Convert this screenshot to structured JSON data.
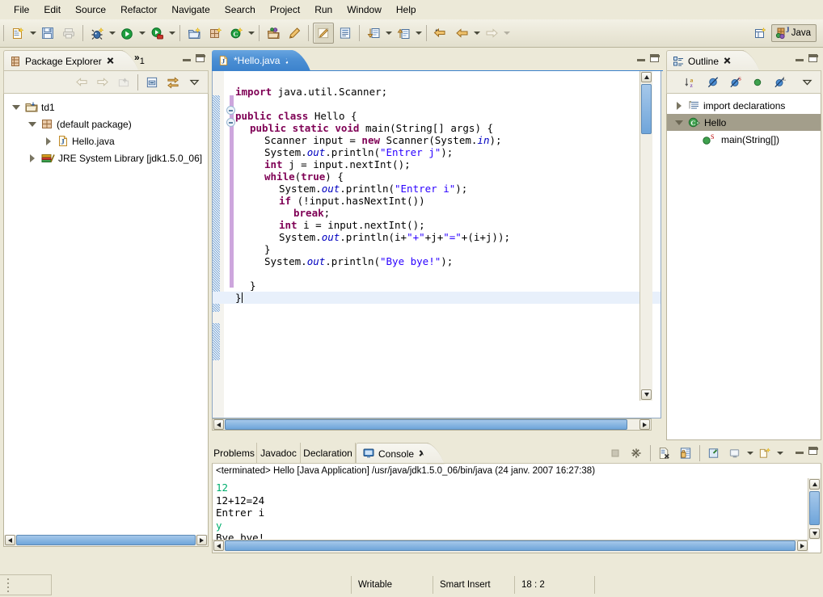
{
  "window": {
    "perspective": "Java"
  },
  "menu": {
    "items": [
      "File",
      "Edit",
      "Source",
      "Refactor",
      "Navigate",
      "Search",
      "Project",
      "Run",
      "Window",
      "Help"
    ]
  },
  "toolbar": {
    "groups": [
      {
        "buttons": [
          {
            "name": "new-wizard",
            "icon": "new-java-file-icon",
            "dropdown": true,
            "pressed": false
          },
          {
            "name": "save",
            "icon": "save-icon",
            "dropdown": false,
            "pressed": false
          },
          {
            "name": "print",
            "icon": "print-icon",
            "dropdown": false,
            "pressed": false
          }
        ]
      },
      {
        "buttons": [
          {
            "name": "debug",
            "icon": "debug-bug-icon",
            "dropdown": true,
            "pressed": false
          },
          {
            "name": "run",
            "icon": "run-play-icon",
            "dropdown": true,
            "pressed": false
          },
          {
            "name": "external-tools",
            "icon": "external-tools-icon",
            "dropdown": true,
            "pressed": false
          }
        ]
      },
      {
        "buttons": [
          {
            "name": "new-java-project",
            "icon": "new-java-project-icon",
            "dropdown": false,
            "pressed": false
          },
          {
            "name": "new-package",
            "icon": "new-package-icon",
            "dropdown": false,
            "pressed": false
          },
          {
            "name": "new-class",
            "icon": "new-class-icon",
            "dropdown": true,
            "pressed": false
          }
        ]
      },
      {
        "buttons": [
          {
            "name": "open-type",
            "icon": "open-type-icon",
            "dropdown": false,
            "pressed": false
          },
          {
            "name": "search",
            "icon": "search-pencil-icon",
            "dropdown": false,
            "pressed": false
          }
        ]
      },
      {
        "buttons": [
          {
            "name": "toggle-mark-occurrences",
            "icon": "mark-occurrences-icon",
            "dropdown": false,
            "pressed": true
          },
          {
            "name": "show-whitespace",
            "icon": "document-icon",
            "dropdown": false,
            "pressed": false
          }
        ]
      },
      {
        "buttons": [
          {
            "name": "next-annotation",
            "icon": "next-annotation-icon",
            "dropdown": true,
            "pressed": false
          },
          {
            "name": "previous-annotation",
            "icon": "previous-annotation-icon",
            "dropdown": true,
            "pressed": false
          }
        ]
      },
      {
        "buttons": [
          {
            "name": "last-edit-location",
            "icon": "last-edit-location-icon",
            "dropdown": false,
            "pressed": false
          },
          {
            "name": "back",
            "icon": "back-arrow-icon",
            "dropdown": true,
            "pressed": false
          },
          {
            "name": "forward",
            "icon": "forward-arrow-icon",
            "dropdown": true,
            "pressed": false,
            "disabled": true
          }
        ]
      }
    ],
    "open_perspective_tooltip": "Open Perspective"
  },
  "package_explorer": {
    "tab_label": "Package Explorer",
    "overflow_label": "»",
    "overflow_count": "1",
    "toolbar": [
      "back-icon",
      "forward-icon",
      "up-icon",
      "collapse-all-icon",
      "link-with-editor-icon",
      "view-menu-icon"
    ],
    "tree": [
      {
        "label": "td1",
        "icon": "java-project-icon",
        "indent": 0,
        "twisty": "down",
        "selected": false
      },
      {
        "label": "(default package)",
        "icon": "package-icon",
        "indent": 1,
        "twisty": "down",
        "selected": false
      },
      {
        "label": "Hello.java",
        "icon": "java-file-icon",
        "indent": 2,
        "twisty": "right",
        "selected": false
      },
      {
        "label": "JRE System Library [jdk1.5.0_06]",
        "icon": "library-icon",
        "indent": 1,
        "twisty": "right",
        "selected": false
      }
    ]
  },
  "editor": {
    "tab_label": "*Hello.java",
    "tab_icon": "java-file-icon",
    "dirty": true,
    "lines": [
      {
        "indent": 0,
        "blank": true,
        "tokens": []
      },
      {
        "indent": 0,
        "tokens": [
          {
            "t": "import",
            "c": "kw"
          },
          {
            "t": " java.util.Scanner;",
            "c": ""
          }
        ]
      },
      {
        "indent": 0,
        "blank": true,
        "tokens": []
      },
      {
        "indent": 0,
        "fold": true,
        "tokens": [
          {
            "t": "public class",
            "c": "kw"
          },
          {
            "t": " Hello {",
            "c": ""
          }
        ]
      },
      {
        "indent": 1,
        "fold": true,
        "tokens": [
          {
            "t": "public static void",
            "c": "kw"
          },
          {
            "t": " main(String[] args) {",
            "c": ""
          }
        ]
      },
      {
        "indent": 2,
        "tokens": [
          {
            "t": "Scanner input = ",
            "c": ""
          },
          {
            "t": "new",
            "c": "kw"
          },
          {
            "t": " Scanner(System.",
            "c": ""
          },
          {
            "t": "in",
            "c": "fld"
          },
          {
            "t": ");",
            "c": ""
          }
        ]
      },
      {
        "indent": 2,
        "tokens": [
          {
            "t": "System.",
            "c": ""
          },
          {
            "t": "out",
            "c": "fld"
          },
          {
            "t": ".println(",
            "c": ""
          },
          {
            "t": "\"Entrer j\"",
            "c": "str"
          },
          {
            "t": ");",
            "c": ""
          }
        ]
      },
      {
        "indent": 2,
        "tokens": [
          {
            "t": "int",
            "c": "kw"
          },
          {
            "t": " j = input.nextInt();",
            "c": ""
          }
        ]
      },
      {
        "indent": 2,
        "tokens": [
          {
            "t": "while",
            "c": "kw"
          },
          {
            "t": "(",
            "c": ""
          },
          {
            "t": "true",
            "c": "kw"
          },
          {
            "t": ") {",
            "c": ""
          }
        ]
      },
      {
        "indent": 3,
        "tokens": [
          {
            "t": "System.",
            "c": ""
          },
          {
            "t": "out",
            "c": "fld"
          },
          {
            "t": ".println(",
            "c": ""
          },
          {
            "t": "\"Entrer i\"",
            "c": "str"
          },
          {
            "t": ");",
            "c": ""
          }
        ]
      },
      {
        "indent": 3,
        "tokens": [
          {
            "t": "if",
            "c": "kw"
          },
          {
            "t": " (!input.hasNextInt())",
            "c": ""
          }
        ]
      },
      {
        "indent": 4,
        "tokens": [
          {
            "t": "break",
            "c": "kw"
          },
          {
            "t": ";",
            "c": ""
          }
        ]
      },
      {
        "indent": 3,
        "tokens": [
          {
            "t": "int",
            "c": "kw"
          },
          {
            "t": " i = input.nextInt();",
            "c": ""
          }
        ]
      },
      {
        "indent": 3,
        "tokens": [
          {
            "t": "System.",
            "c": ""
          },
          {
            "t": "out",
            "c": "fld"
          },
          {
            "t": ".println(i+",
            "c": ""
          },
          {
            "t": "\"+\"",
            "c": "str"
          },
          {
            "t": "+j+",
            "c": ""
          },
          {
            "t": "\"=\"",
            "c": "str"
          },
          {
            "t": "+(i+j));",
            "c": ""
          }
        ]
      },
      {
        "indent": 2,
        "tokens": [
          {
            "t": "}",
            "c": ""
          }
        ]
      },
      {
        "indent": 2,
        "tokens": [
          {
            "t": "System.",
            "c": ""
          },
          {
            "t": "out",
            "c": "fld"
          },
          {
            "t": ".println(",
            "c": ""
          },
          {
            "t": "\"Bye bye!\"",
            "c": "str"
          },
          {
            "t": ");",
            "c": ""
          }
        ]
      },
      {
        "indent": 0,
        "blank": true,
        "tokens": []
      },
      {
        "indent": 1,
        "tokens": [
          {
            "t": "}",
            "c": ""
          }
        ]
      },
      {
        "indent": 0,
        "current": true,
        "caret": true,
        "tokens": [
          {
            "t": "}",
            "c": ""
          }
        ]
      }
    ]
  },
  "outline": {
    "tab_label": "Outline",
    "toolbar": [
      "sort-icon",
      "hide-fields-icon",
      "hide-static-icon",
      "hide-non-public-icon",
      "hide-local-types-icon",
      "view-menu-icon"
    ],
    "items": [
      {
        "label": "import declarations",
        "icon": "import-declarations-icon",
        "indent": 0,
        "twisty": "right",
        "selected": false
      },
      {
        "label": "Hello",
        "icon": "java-class-icon",
        "indent": 0,
        "twisty": "down",
        "selected": true
      },
      {
        "label": "main(String[])",
        "icon": "public-method-static-icon",
        "indent": 1,
        "twisty": "none",
        "selected": false
      }
    ]
  },
  "bottom": {
    "tabs": [
      {
        "label": "Problems",
        "active": false,
        "icon": "none"
      },
      {
        "label": "Javadoc",
        "active": false,
        "icon": "none"
      },
      {
        "label": "Declaration",
        "active": false,
        "icon": "none"
      },
      {
        "label": "Console",
        "active": true,
        "icon": "console-icon"
      }
    ],
    "toolbar": [
      "terminate-icon",
      "remove-all-terminated-icon",
      "remove-launch-icon",
      "clear-console-icon",
      "scroll-lock-icon",
      "pin-console-icon",
      "display-selected-console-icon",
      "open-console-icon"
    ],
    "console": {
      "header": "<terminated> Hello [Java Application] /usr/java/jdk1.5.0_06/bin/java (24 janv. 2007 16:27:38)",
      "lines": [
        {
          "text": "12",
          "kind": "input"
        },
        {
          "text": "12+12=24",
          "kind": "output"
        },
        {
          "text": "Entrer i",
          "kind": "output"
        },
        {
          "text": "y",
          "kind": "input"
        },
        {
          "text": "Bye bye!",
          "kind": "output"
        }
      ]
    }
  },
  "status": {
    "writable": "Writable",
    "insert_mode": "Smart Insert",
    "position": "18 : 2"
  },
  "colors": {
    "keyword": "#7f0055",
    "string": "#2a00ff",
    "field": "#0000c0",
    "console_input": "#00af6e",
    "tab_active": "#4b8fd4",
    "selection": "#a39e8b",
    "chrome": "#ece9d8"
  }
}
